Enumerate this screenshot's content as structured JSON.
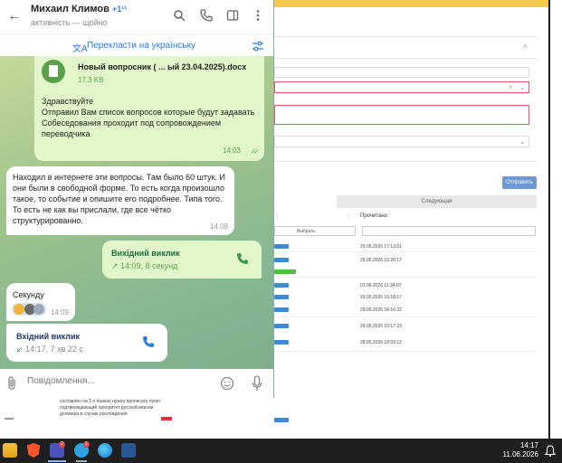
{
  "chat": {
    "contact_name": "Михаил Климов",
    "contact_plus": "+1¹¹",
    "status": "активність — щойно",
    "translate_label": "Перекласти на українську",
    "messages": {
      "file": {
        "filename": "Новый вопросник ( ... ый 23.04.2025).docx",
        "size": "17.3 KB",
        "text": "Здравствуйте\nОтправил Вам список вопросов которые будут задавать\nСобеседования проходит под сопровождением переводчика",
        "time": "14:03"
      },
      "incoming_text": {
        "text": "Находил в интернете эти вопросы. Там было 60 штук. И они были в свободной форме. То есть когда произошло такое, то событие и опишите его подробнее. Типа того. То есть не как вы прислали, где все чётко структурированно.",
        "time": "14:08"
      },
      "call_out": {
        "title": "Вихідний виклик",
        "details": "14:09, 8 секунд"
      },
      "short": {
        "text": "Секунду",
        "time": "14:09"
      },
      "call_in": {
        "title": "Вхідний виклик",
        "details": "14:17, 7 хв 22 с"
      }
    },
    "composer_placeholder": "Повідомлення..."
  },
  "background": {
    "send_button": "Отправить",
    "next_tab": "Следующая",
    "column_header": "Прочитано",
    "filter_select": "Выбрать",
    "dates": [
      "29.05.2026 17:13:01",
      "29.05.2026 16:20:17",
      "01.06.2026 11:34:07",
      "29.05.2026 16:18:17",
      "29.05.2026 16:16:32",
      "29.05.2026 10:17:23",
      "28.05.2026 18:03:12"
    ],
    "bottom_text": "составлен на 2-х языках нужно прописать пункт подтверждающий приоритет русской версии договора в случае расхождения"
  },
  "taskbar": {
    "time": "14:17",
    "date": "11.06.2026",
    "teams_badge": "2",
    "telegram_badge": "1"
  }
}
